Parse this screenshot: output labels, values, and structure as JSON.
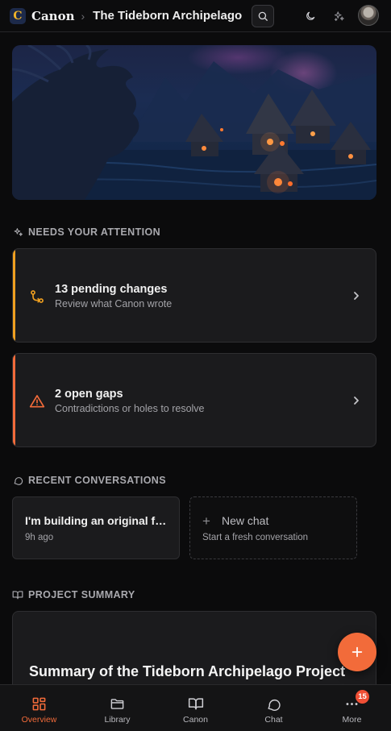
{
  "header": {
    "logo_letter": "C",
    "app_name": "Canon",
    "separator": "›",
    "project_title": "The Tideborn Archipelago",
    "icons": [
      "search-icon",
      "moon-icon",
      "sparkles-icon"
    ]
  },
  "attention": {
    "heading": "NEEDS YOUR ATTENTION",
    "cards": [
      {
        "title": "13 pending changes",
        "subtitle": "Review what Canon wrote",
        "icon": "git-pull-request-icon",
        "accent": "#f0a020"
      },
      {
        "title": "2 open gaps",
        "subtitle": "Contradictions or holes to resolve",
        "icon": "warning-triangle-icon",
        "accent": "#f26b3a"
      }
    ]
  },
  "conversations": {
    "heading": "RECENT CONVERSATIONS",
    "items": [
      {
        "title": "I'm building an original fantasy world and want to ...",
        "time": "9h ago"
      }
    ],
    "new_chat": {
      "label": "New chat",
      "subtitle": "Start a fresh conversation",
      "plus": "+"
    }
  },
  "summary": {
    "heading": "PROJECT SUMMARY",
    "title": "Summary of the Tideborn Archipelago Project"
  },
  "nav": {
    "items": [
      {
        "label": "Overview",
        "icon": "grid-icon",
        "active": true
      },
      {
        "label": "Library",
        "icon": "folder-icon",
        "active": false
      },
      {
        "label": "Canon",
        "icon": "book-open-icon",
        "active": false
      },
      {
        "label": "Chat",
        "icon": "chat-bubble-icon",
        "active": false
      },
      {
        "label": "More",
        "icon": "more-dots-icon",
        "active": false,
        "badge": "15"
      }
    ]
  },
  "colors": {
    "accent": "#f26b3a",
    "warning": "#f0a020",
    "background": "#0b0b0c",
    "card": "#1b1b1d"
  }
}
